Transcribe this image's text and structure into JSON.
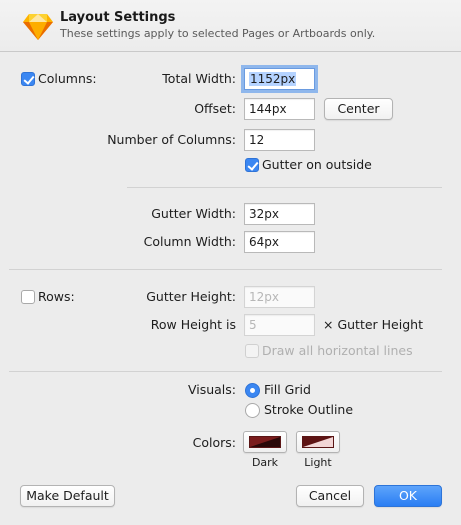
{
  "header": {
    "title": "Layout Settings",
    "subtitle": "These settings apply to selected Pages or Artboards only."
  },
  "columns": {
    "label": "Columns:",
    "enabled": true,
    "total_width_label": "Total Width:",
    "total_width_value": "1152px",
    "offset_label": "Offset:",
    "offset_value": "144px",
    "center_button": "Center",
    "number_label": "Number of Columns:",
    "number_value": "12",
    "gutter_outside_label": "Gutter on outside",
    "gutter_outside_checked": true,
    "gutter_width_label": "Gutter Width:",
    "gutter_width_value": "32px",
    "column_width_label": "Column Width:",
    "column_width_value": "64px"
  },
  "rows": {
    "label": "Rows:",
    "enabled": false,
    "gutter_height_label": "Gutter Height:",
    "gutter_height_placeholder": "12px",
    "row_height_label": "Row Height is",
    "row_height_placeholder": "5",
    "row_height_suffix": "× Gutter Height",
    "draw_lines_label": "Draw all horizontal lines"
  },
  "visuals": {
    "label": "Visuals:",
    "options": [
      "Fill Grid",
      "Stroke Outline"
    ],
    "selected": "Fill Grid"
  },
  "colors": {
    "label": "Colors:",
    "dark_label": "Dark",
    "light_label": "Light",
    "dark_color": "#7a1c1c",
    "light_color": "#6b1a1a"
  },
  "footer": {
    "make_default": "Make Default",
    "cancel": "Cancel",
    "ok": "OK"
  },
  "theme": {
    "accent": "#3b87f2",
    "sketch_logo_colors": [
      "#fdb300",
      "#ea6c00",
      "#fdad00",
      "#fdd231"
    ]
  }
}
